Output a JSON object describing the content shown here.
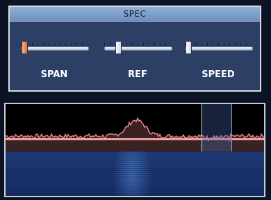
{
  "spec_panel": {
    "title": "SPEC",
    "controls": [
      {
        "label": "SPAN",
        "level": 0.0,
        "active": true
      },
      {
        "label": "REF",
        "level": 0.2,
        "active": false
      },
      {
        "label": "SPEED",
        "level": 0.0,
        "active": false
      }
    ]
  },
  "colors": {
    "panel_bg": "#2e3f66",
    "title_bar": "#7fa0c9",
    "spectrum_trace": "#e88888",
    "waterfall": "#1f3b78",
    "active_thumb": "#e86c2c"
  },
  "display": {
    "spectrum_peak_level": 0.62,
    "noise_floor_level": 0.28,
    "marker_position": 0.78
  }
}
